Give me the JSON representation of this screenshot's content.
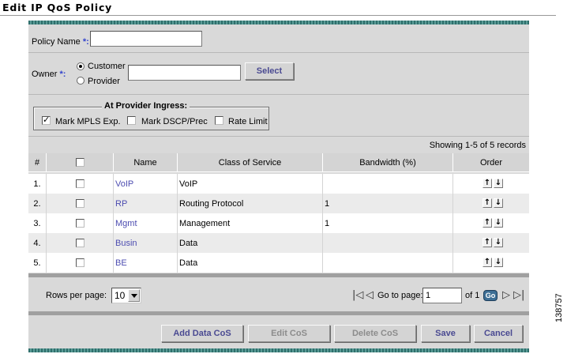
{
  "page": {
    "title": "Edit IP QoS Policy"
  },
  "form": {
    "policy_name_label": "Policy Name",
    "required_mark": "*:",
    "policy_name_value": "",
    "owner_label": "Owner",
    "owner_options": [
      "Customer",
      "Provider"
    ],
    "owner_selected": "Customer",
    "owner_value": "",
    "select_button": "Select"
  },
  "ingress": {
    "legend": "At Provider Ingress:",
    "options": [
      {
        "label": "Mark MPLS Exp.",
        "checked": true
      },
      {
        "label": "Mark DSCP/Prec",
        "checked": false
      },
      {
        "label": "Rate Limit",
        "checked": false
      }
    ]
  },
  "table": {
    "records_text": "Showing 1-5 of 5 records",
    "columns": [
      "#",
      "",
      "Name",
      "Class of Service",
      "Bandwidth (%)",
      "Order"
    ],
    "rows": [
      {
        "num": "1.",
        "name": "VoIP",
        "cos": "VoIP",
        "bandwidth": ""
      },
      {
        "num": "2.",
        "name": "RP",
        "cos": "Routing Protocol",
        "bandwidth": "1"
      },
      {
        "num": "3.",
        "name": "Mgmt",
        "cos": "Management",
        "bandwidth": "1"
      },
      {
        "num": "4.",
        "name": "Busin",
        "cos": "Data",
        "bandwidth": ""
      },
      {
        "num": "5.",
        "name": "BE",
        "cos": "Data",
        "bandwidth": ""
      }
    ]
  },
  "pagination": {
    "rows_per_page_label": "Rows per page:",
    "rows_per_page": "10",
    "go_to_page_label": "Go to page:",
    "page_value": "1",
    "of_text": "of 1",
    "go_label": "Go"
  },
  "actions": {
    "add_data_cos": "Add Data CoS",
    "edit_cos": "Edit CoS",
    "delete_cos": "Delete CoS",
    "save": "Save",
    "cancel": "Cancel"
  },
  "figure_id": "138757"
}
